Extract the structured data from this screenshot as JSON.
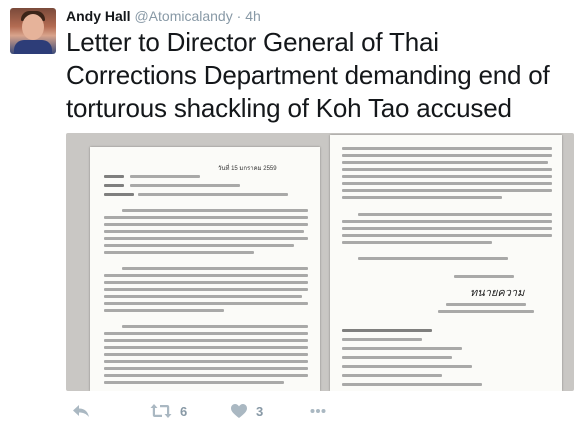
{
  "tweet": {
    "author_name": "Andy Hall",
    "handle": "@Atomicalandy",
    "separator": "·",
    "time": "4h",
    "text": "Letter to Director General of Thai Corrections Department demanding end of torturous shackling of Koh Tao accused",
    "media": {
      "left_doc_date": "วันที่ 15 มกราคม 2559",
      "signature": "ทนายความ"
    }
  },
  "actions": {
    "reply_icon": "reply-icon",
    "retweet_icon": "retweet-icon",
    "retweet_count": "6",
    "like_icon": "heart-icon",
    "like_count": "3",
    "more_icon": "more-icon"
  },
  "colors": {
    "name": "#14171a",
    "meta": "#8899a6",
    "action_icon": "#aab8c2"
  }
}
